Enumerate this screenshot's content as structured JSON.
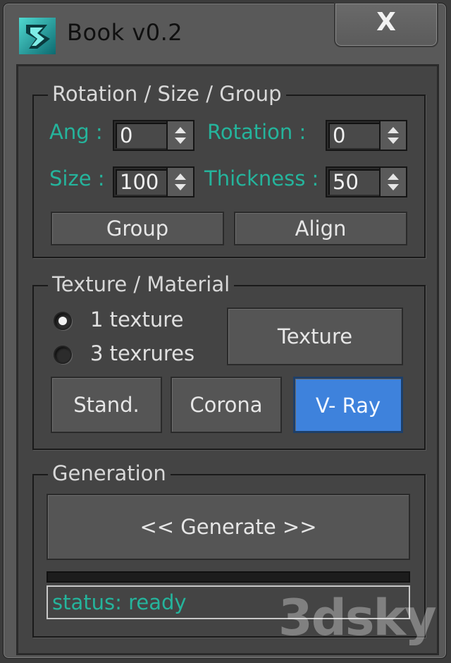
{
  "window": {
    "title": "Book v0.2",
    "close_label": "X"
  },
  "rotation_group": {
    "legend": "Rotation / Size / Group",
    "ang_label": "Ang :",
    "ang_value": "0",
    "rotation_label": "Rotation  :",
    "rotation_value": "0",
    "size_label": "Size :",
    "size_value": "100",
    "thickness_label": "Thickness :",
    "thickness_value": "50",
    "group_button": "Group",
    "align_button": "Align"
  },
  "texture_group": {
    "legend": "Texture / Material",
    "radio_1": "1 texture",
    "radio_3": "3 texrures",
    "selected_radio": "1 texture",
    "texture_button": "Texture",
    "material_buttons": [
      "Stand.",
      "Corona",
      "V- Ray"
    ],
    "active_material": "V- Ray"
  },
  "generation_group": {
    "legend": "Generation",
    "generate_button": "<<  Generate  >>",
    "progress": 0,
    "status": "status: ready"
  },
  "watermark": "3dsky",
  "colors": {
    "label_teal": "#25b49c",
    "active_blue": "#3e82dc",
    "panel_bg": "#444444"
  },
  "icons": {
    "app": "3ds-max-logo-icon",
    "spinner_up": "spinner-up-arrow-icon",
    "spinner_down": "spinner-down-arrow-icon"
  }
}
